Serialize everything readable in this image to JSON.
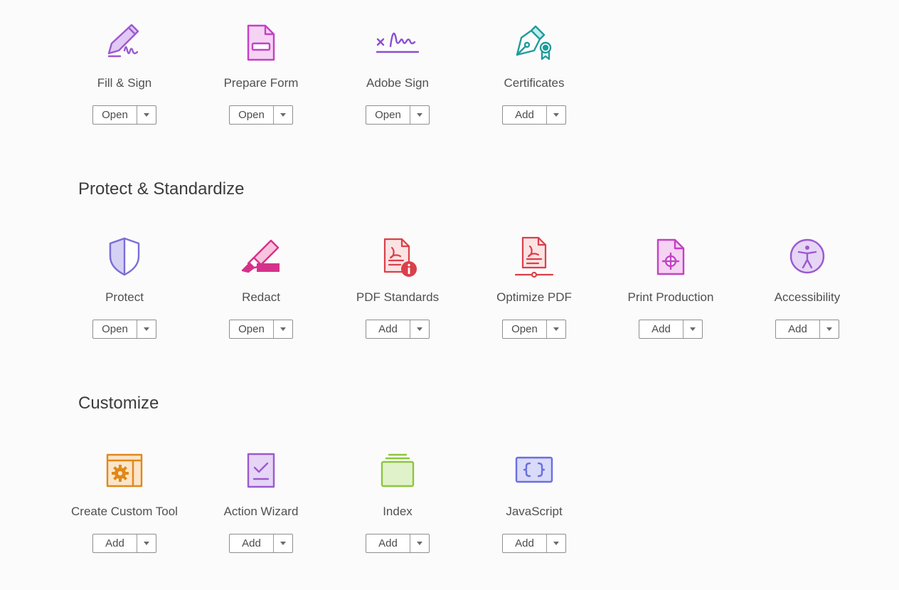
{
  "sections": {
    "protect": {
      "title": "Protect & Standardize"
    },
    "customize": {
      "title": "Customize"
    }
  },
  "tools": {
    "fill_sign": {
      "label": "Fill & Sign",
      "action": "Open"
    },
    "prepare_form": {
      "label": "Prepare Form",
      "action": "Open"
    },
    "adobe_sign": {
      "label": "Adobe Sign",
      "action": "Open"
    },
    "certificates": {
      "label": "Certificates",
      "action": "Add"
    },
    "protect": {
      "label": "Protect",
      "action": "Open"
    },
    "redact": {
      "label": "Redact",
      "action": "Open"
    },
    "pdf_standards": {
      "label": "PDF Standards",
      "action": "Add"
    },
    "optimize_pdf": {
      "label": "Optimize PDF",
      "action": "Open"
    },
    "print_production": {
      "label": "Print Production",
      "action": "Add"
    },
    "accessibility": {
      "label": "Accessibility",
      "action": "Add"
    },
    "create_custom_tool": {
      "label": "Create Custom Tool",
      "action": "Add"
    },
    "action_wizard": {
      "label": "Action Wizard",
      "action": "Add"
    },
    "index": {
      "label": "Index",
      "action": "Add"
    },
    "javascript": {
      "label": "JavaScript",
      "action": "Add"
    }
  },
  "icons": {
    "fill_sign": "pen-signature-icon",
    "prepare_form": "form-document-icon",
    "adobe_sign": "signature-line-icon",
    "certificates": "fountain-pen-certificate-icon",
    "protect": "shield-icon",
    "redact": "highlighter-icon",
    "pdf_standards": "pdf-info-icon",
    "optimize_pdf": "pdf-optimize-icon",
    "print_production": "print-crosshair-icon",
    "accessibility": "accessibility-person-icon",
    "create_custom_tool": "gear-window-icon",
    "action_wizard": "checklist-icon",
    "index": "stacked-index-icon",
    "javascript": "curly-braces-icon"
  },
  "colors": {
    "purple": "#9b59d0",
    "magenta": "#c341c4",
    "teal": "#1f9b9b",
    "lavender": "#7a6fd6",
    "pink": "#d6318a",
    "red": "#d9404a",
    "orange": "#e0881b",
    "green": "#8cc63f",
    "indigo": "#6a6fe0"
  }
}
